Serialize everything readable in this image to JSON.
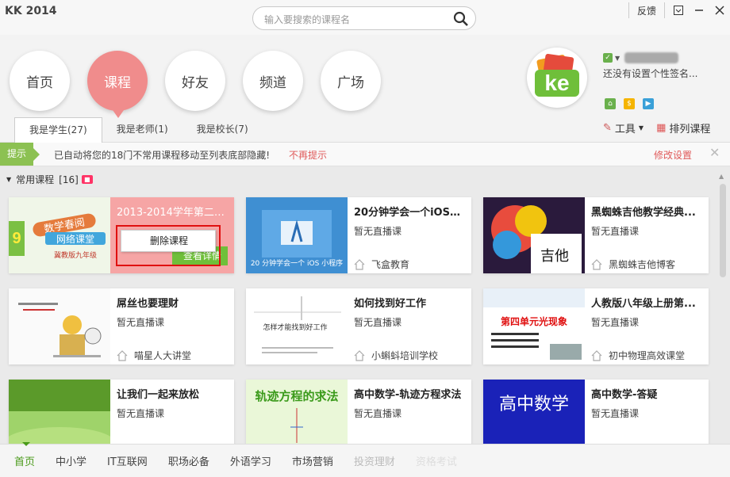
{
  "app": {
    "title": "KK 2014"
  },
  "search": {
    "placeholder": "输入要搜索的课程名"
  },
  "titlebar": {
    "feedback": "反馈"
  },
  "nav": [
    {
      "label": "首页"
    },
    {
      "label": "课程"
    },
    {
      "label": "好友"
    },
    {
      "label": "频道"
    },
    {
      "label": "广场"
    }
  ],
  "subtabs": [
    {
      "label": "我是学生(27)"
    },
    {
      "label": "我是老师(1)"
    },
    {
      "label": "我是校长(7)"
    }
  ],
  "user": {
    "signature": "还没有设置个性签名...",
    "avatar_text": "ke",
    "online_badge": "✓"
  },
  "tools": {
    "tools_label": "工具",
    "sort_label": "排列课程"
  },
  "notice": {
    "tag": "提示",
    "text": "已自动将您的18门不常用课程移动至列表底部隐藏!",
    "dismiss": "不再提示",
    "settings": "修改设置",
    "close": "✕"
  },
  "section": {
    "title": "常用课程",
    "count": "[16]"
  },
  "cards": [
    {
      "title": "2013-2014学年第二学...",
      "status": "",
      "org": "",
      "thumb_lines": [
        "数学春阅",
        "网络课堂",
        "冀教版九年级"
      ],
      "extra": "查看详情"
    },
    {
      "title": "20分钟学会一个iOS小...",
      "status": "暂无直播课",
      "org": "飞盒教育",
      "thumb_caption": "20 分钟学会一个 iOS 小程序"
    },
    {
      "title": "黑蜘蛛吉他教学经典...",
      "status": "暂无直播课",
      "org": "黑蜘蛛吉他博客",
      "thumb_caption": "吉他"
    },
    {
      "title": "屌丝也要理财",
      "status": "暂无直播课",
      "org": "喵星人大讲堂"
    },
    {
      "title": "如何找到好工作",
      "status": "暂无直播课",
      "org": "小蝌蚪培训学校",
      "thumb_caption": "怎样才能找到好工作"
    },
    {
      "title": "人教版八年级上册第...",
      "status": "暂无直播课",
      "org": "初中物理高效课堂",
      "thumb_caption": "第四单元光现象"
    },
    {
      "title": "让我们一起来放松",
      "status": "暂无直播课",
      "org": ""
    },
    {
      "title": "高中数学-轨迹方程求法",
      "status": "暂无直播课",
      "org": "",
      "thumb_caption": "轨迹方程的求法"
    },
    {
      "title": "高中数学-答疑",
      "status": "暂无直播课",
      "org": "",
      "thumb_caption": "高中数学"
    }
  ],
  "context_menu": {
    "delete": "删除课程"
  },
  "bottomnav": [
    {
      "label": "首页"
    },
    {
      "label": "中小学"
    },
    {
      "label": "IT互联网"
    },
    {
      "label": "职场必备"
    },
    {
      "label": "外语学习"
    },
    {
      "label": "市场营销"
    },
    {
      "label": "投资理财"
    },
    {
      "label": "资格考试"
    }
  ]
}
